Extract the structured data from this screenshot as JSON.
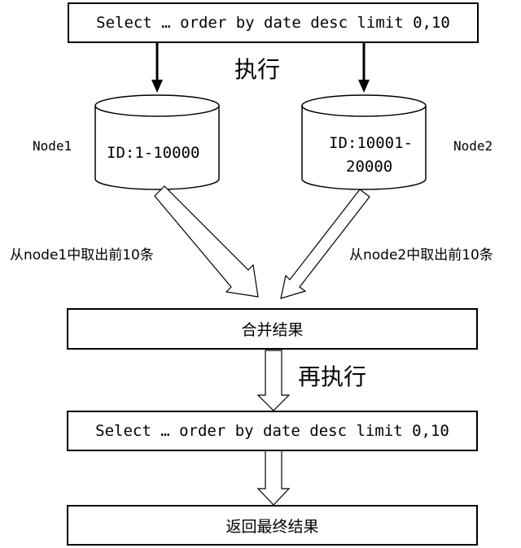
{
  "query_top": "Select … order by date desc limit 0,10",
  "exec_label": "执行",
  "node1": {
    "name": "Node1",
    "id_range": "ID:1-10000"
  },
  "node2": {
    "name": "Node2",
    "id_line1": "ID:10001-",
    "id_line2": "20000"
  },
  "take_node1": "从node1中取出前10条",
  "take_node2": "从node2中取出前10条",
  "merge_label": "合并结果",
  "re_exec_label": "再执行",
  "query_bottom": "Select … order by date desc limit 0,10",
  "return_label": "返回最终结果"
}
